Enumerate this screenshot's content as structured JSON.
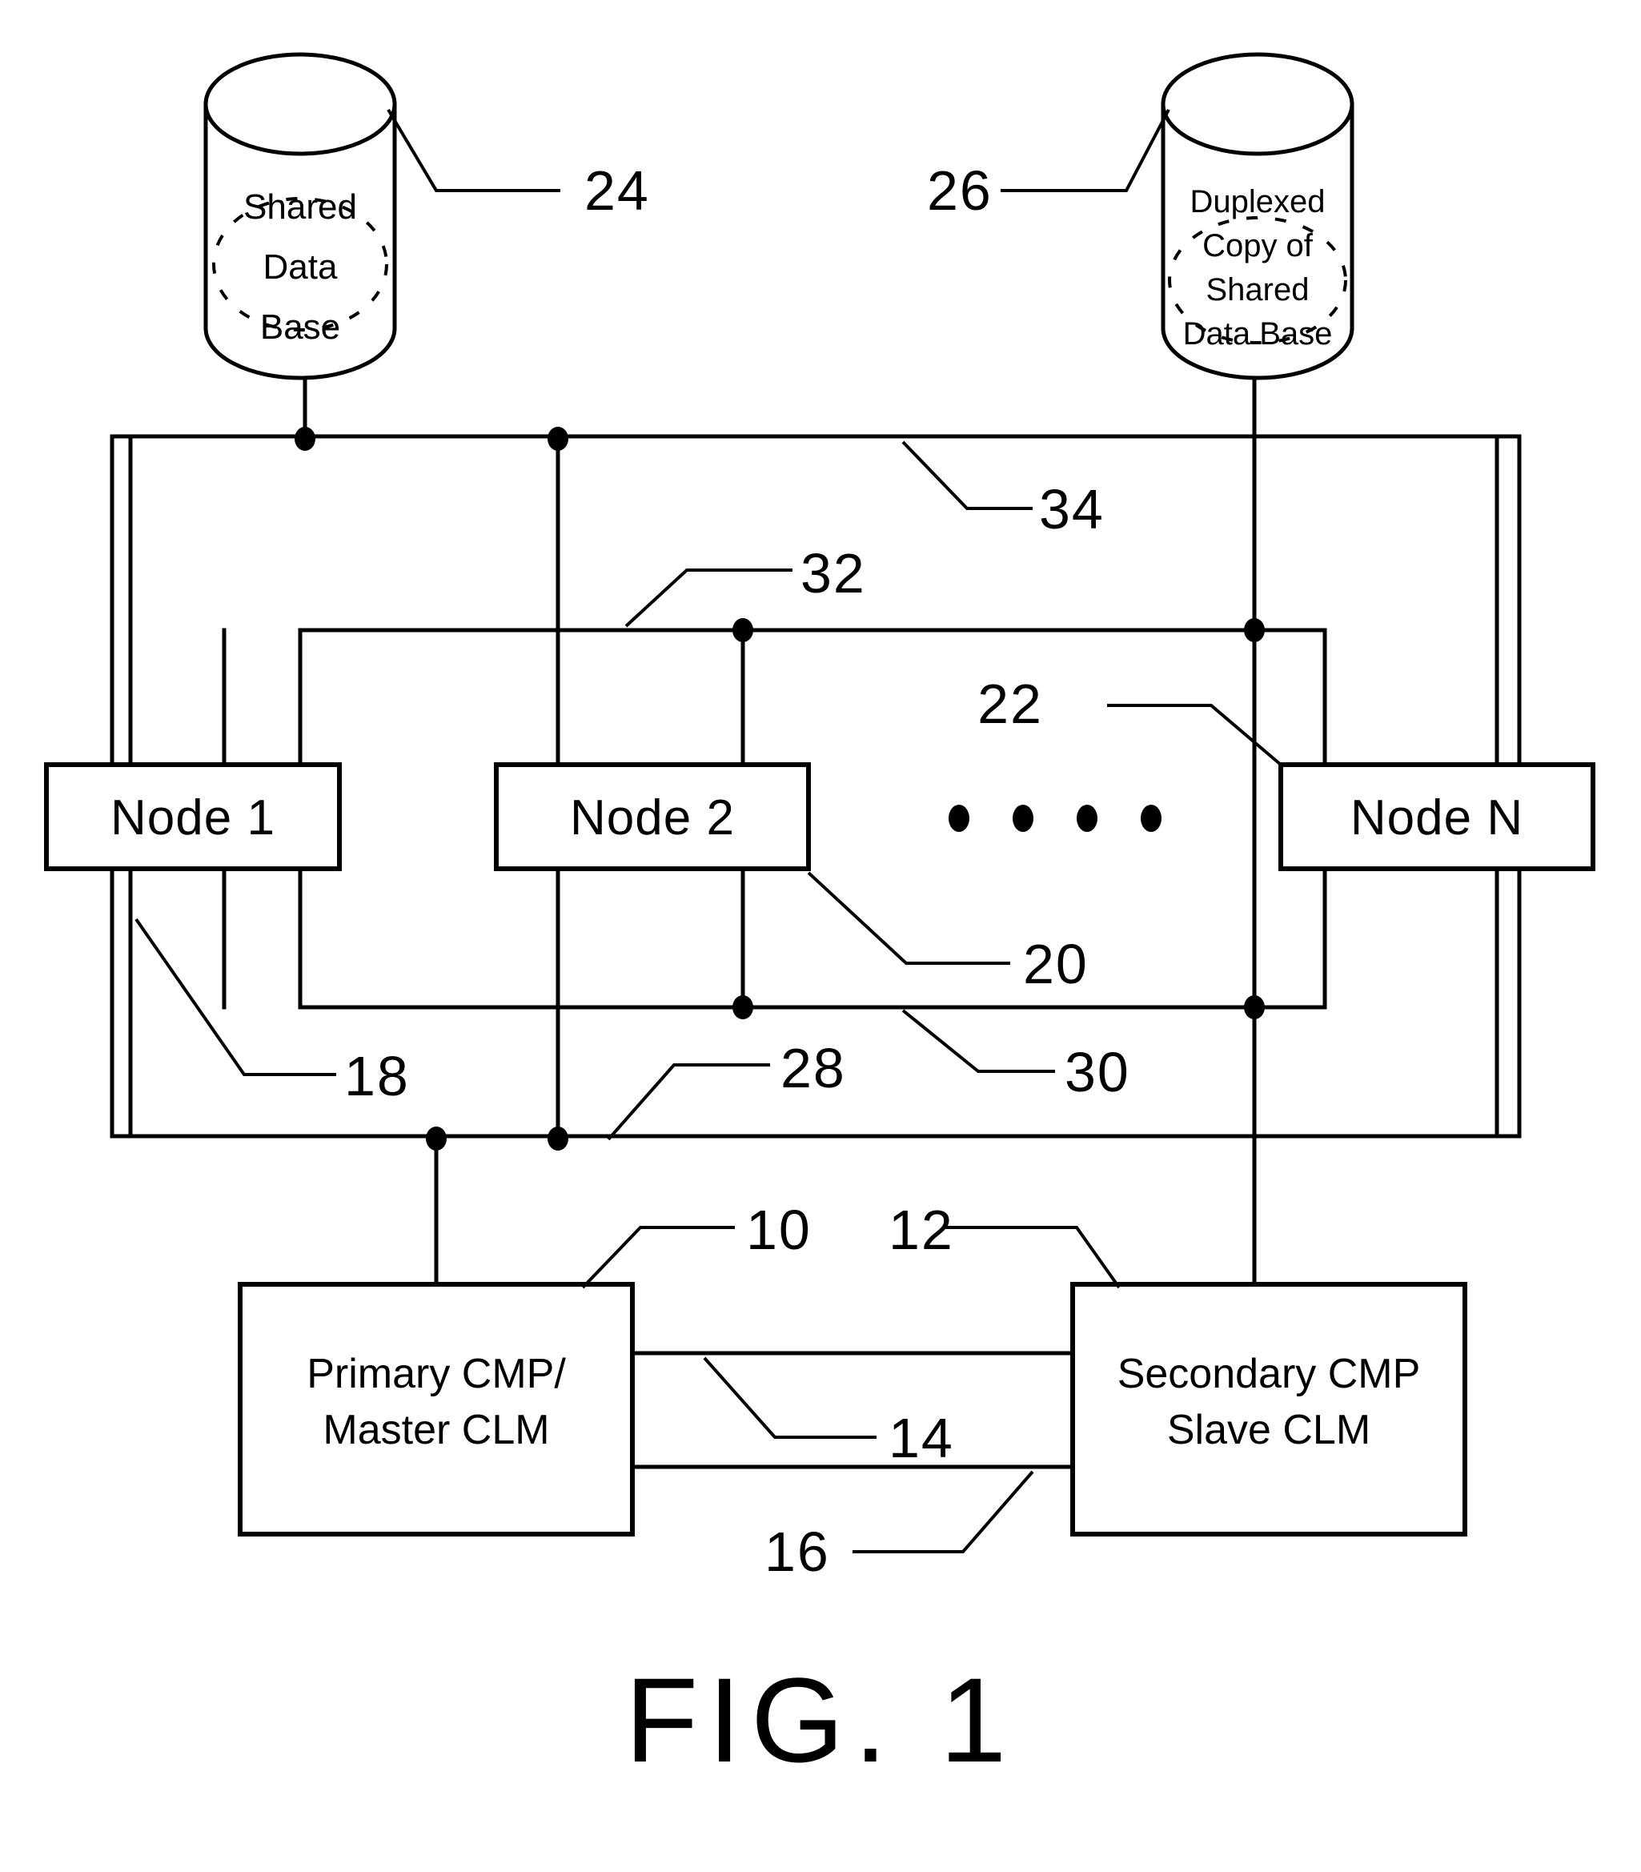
{
  "figure": {
    "caption": "FIG. 1",
    "title": "Patent figure: distributed database node architecture"
  },
  "databases": [
    {
      "id": "shared-db",
      "lines": [
        "Shared",
        "Data",
        "Base"
      ],
      "ref": "24"
    },
    {
      "id": "duplexed-db",
      "lines": [
        "Duplexed",
        "Copy of",
        "Shared",
        "Data Base"
      ],
      "ref": "26"
    }
  ],
  "nodes": [
    {
      "id": "node-1",
      "label": "Node 1"
    },
    {
      "id": "node-2",
      "label": "Node 2"
    },
    {
      "id": "node-n",
      "label": "Node N"
    }
  ],
  "ellipsis": "• • • •",
  "processors": [
    {
      "id": "primary-cmp",
      "lines": [
        "Primary CMP/",
        "Master CLM"
      ],
      "ref": "10"
    },
    {
      "id": "secondary-cmp",
      "lines": [
        "Secondary CMP",
        "Slave CLM"
      ],
      "ref": "12"
    }
  ],
  "reference_numerals": {
    "ref_10": "10",
    "ref_12": "12",
    "ref_14": "14",
    "ref_16": "16",
    "ref_18": "18",
    "ref_20": "20",
    "ref_22": "22",
    "ref_24": "24",
    "ref_26": "26",
    "ref_28": "28",
    "ref_30": "30",
    "ref_32": "32",
    "ref_34": "34"
  },
  "colors": {
    "ink": "#000000",
    "paper": "#ffffff"
  }
}
